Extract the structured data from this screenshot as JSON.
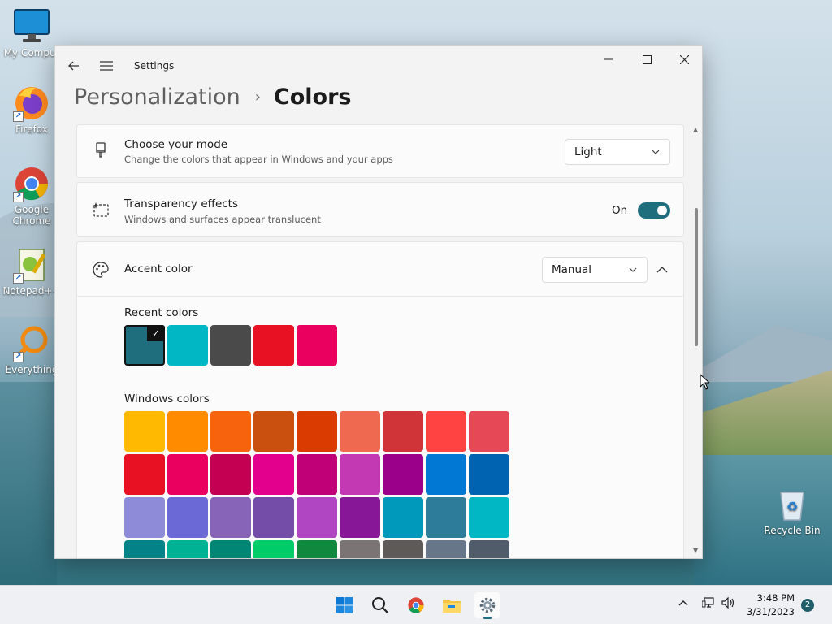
{
  "desktop": {
    "icons": [
      {
        "label": "My Comput"
      },
      {
        "label": "Firefox"
      },
      {
        "label": "Google Chrome"
      },
      {
        "label": "Notepad++"
      },
      {
        "label": "Everything"
      },
      {
        "label": "Recycle Bin"
      }
    ]
  },
  "window": {
    "app_title": "Settings",
    "breadcrumb": {
      "parent": "Personalization",
      "separator": "›",
      "current": "Colors"
    },
    "mode": {
      "title": "Choose your mode",
      "subtitle": "Change the colors that appear in Windows and your apps",
      "value": "Light"
    },
    "transparency": {
      "title": "Transparency effects",
      "subtitle": "Windows and surfaces appear translucent",
      "state_label": "On",
      "enabled": true
    },
    "accent": {
      "title": "Accent color",
      "value": "Manual",
      "recent_label": "Recent colors",
      "recent_colors": [
        "#1f6e7d",
        "#00b7c3",
        "#4a4a4a",
        "#e81123",
        "#ea005e"
      ],
      "selected_recent": 0,
      "windows_label": "Windows colors",
      "windows_colors": [
        [
          "#ffb900",
          "#ff8c00",
          "#f7630c",
          "#ca5010",
          "#da3b01",
          "#ef6950",
          "#d13438",
          "#ff4343",
          "#e74856"
        ],
        [
          "#e81123",
          "#ea005e",
          "#c30052",
          "#e3008c",
          "#bf0077",
          "#c239b3",
          "#9a0089",
          "#0078d4",
          "#0063b1"
        ],
        [
          "#8e8cd8",
          "#6b69d6",
          "#8764b8",
          "#744da9",
          "#b146c2",
          "#881798",
          "#0099bc",
          "#2d7d9a",
          "#00b7c3"
        ],
        [
          "#038387",
          "#00b294",
          "#018574",
          "#00cc6a",
          "#10893e",
          "#7a7574",
          "#5d5a58",
          "#68768a",
          "#515c6b"
        ]
      ]
    }
  },
  "taskbar": {
    "clock": {
      "time": "3:48 PM",
      "date": "3/31/2023"
    },
    "notification_count": "2"
  }
}
